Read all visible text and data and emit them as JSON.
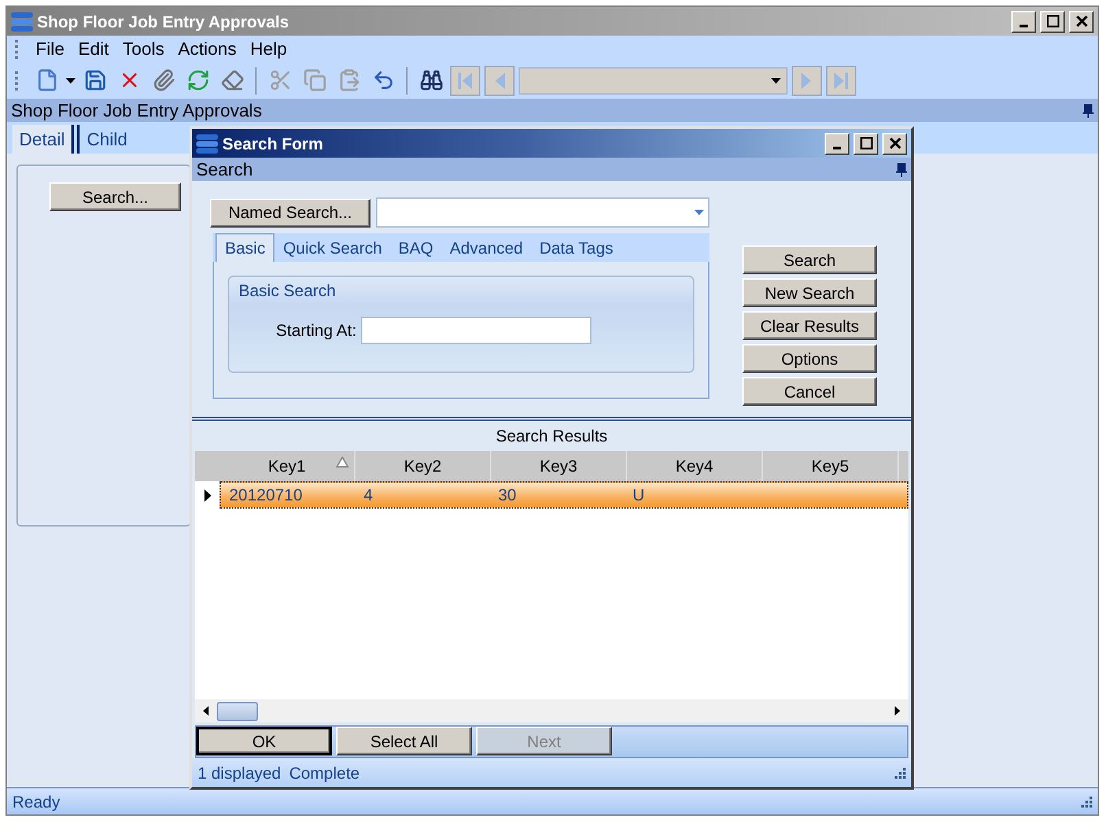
{
  "main_window": {
    "title": "Shop Floor Job Entry Approvals"
  },
  "menu": [
    "File",
    "Edit",
    "Tools",
    "Actions",
    "Help"
  ],
  "toolbar": [
    {
      "kind": "new",
      "disabled": false
    },
    {
      "kind": "save",
      "disabled": false
    },
    {
      "kind": "delete",
      "disabled": false
    },
    {
      "kind": "attach",
      "disabled": false
    },
    {
      "kind": "refresh",
      "disabled": false
    },
    {
      "kind": "clear",
      "disabled": false
    },
    {
      "kind": "separator"
    },
    {
      "kind": "cut",
      "disabled": true
    },
    {
      "kind": "copy",
      "disabled": true
    },
    {
      "kind": "paste",
      "disabled": true
    },
    {
      "kind": "undo",
      "disabled": false
    },
    {
      "kind": "separator"
    },
    {
      "kind": "search",
      "disabled": false
    },
    {
      "kind": "first",
      "disabled": true
    },
    {
      "kind": "prev",
      "disabled": true
    },
    {
      "kind": "combo",
      "disabled": true
    },
    {
      "kind": "next",
      "disabled": true
    },
    {
      "kind": "last",
      "disabled": true
    }
  ],
  "panel_title": "Shop Floor Job Entry Approvals",
  "tabs": [
    {
      "label": "Detail",
      "selected": true
    },
    {
      "label": "Child",
      "selected": false
    }
  ],
  "search_button": "Search...",
  "dialog": {
    "title": "Search Form",
    "header": "Search",
    "named_search": "Named Search...",
    "tabs": [
      {
        "label": "Basic",
        "selected": true
      },
      {
        "label": "Quick Search",
        "selected": false
      },
      {
        "label": "BAQ",
        "selected": false
      },
      {
        "label": "Advanced",
        "selected": false
      },
      {
        "label": "Data Tags",
        "selected": false
      }
    ],
    "group_title": "Basic Search",
    "field_label": "Starting At:",
    "actions": [
      "Search",
      "New Search",
      "Clear Results",
      "Options",
      "Cancel"
    ],
    "results_title": "Search Results",
    "columns": [
      {
        "label": "Key1",
        "sorted": true
      },
      {
        "label": "Key2",
        "sorted": false
      },
      {
        "label": "Key3",
        "sorted": false
      },
      {
        "label": "Key4",
        "sorted": false
      },
      {
        "label": "Key5",
        "sorted": false
      }
    ],
    "rows": [
      {
        "selected": true,
        "cells": [
          "20120710",
          "4",
          "30",
          "U"
        ]
      }
    ],
    "footer_buttons": [
      {
        "label": "OK",
        "disabled": false,
        "default": true
      },
      {
        "label": "Select All",
        "disabled": false,
        "default": false
      },
      {
        "label": "Next",
        "disabled": true,
        "default": false
      }
    ],
    "status": [
      "1 displayed",
      "Complete"
    ]
  },
  "status_bar": "Ready"
}
